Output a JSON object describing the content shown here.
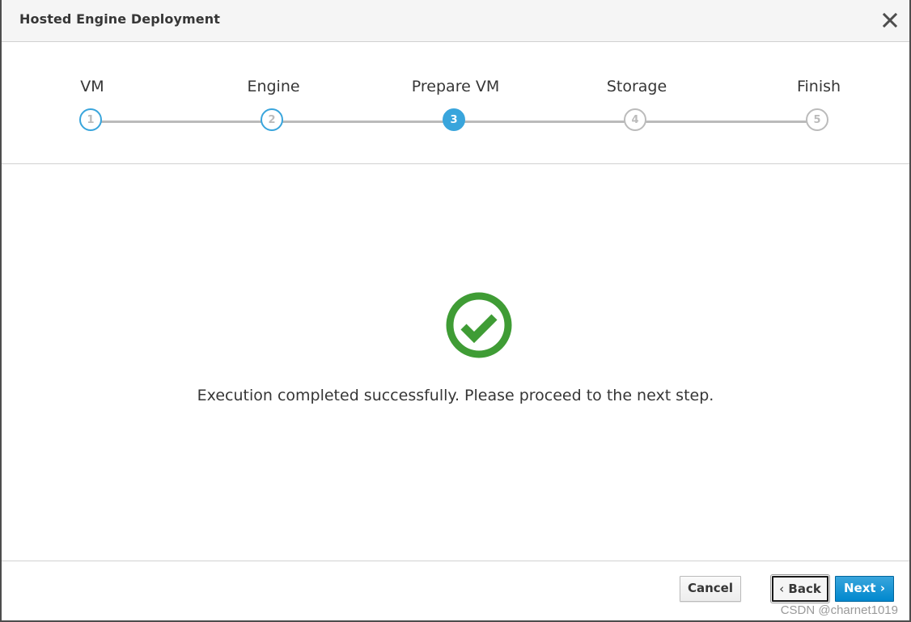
{
  "dialog": {
    "title": "Hosted Engine Deployment",
    "close_icon": "close-x-icon"
  },
  "wizard": {
    "steps": [
      {
        "number": "1",
        "label": "VM",
        "state": "done"
      },
      {
        "number": "2",
        "label": "Engine",
        "state": "done"
      },
      {
        "number": "3",
        "label": "Prepare VM",
        "state": "active"
      },
      {
        "number": "4",
        "label": "Storage",
        "state": "pending"
      },
      {
        "number": "5",
        "label": "Finish",
        "state": "pending"
      }
    ],
    "current_step": 3
  },
  "content": {
    "status_icon": "success-check-circle-icon",
    "message": "Execution completed successfully. Please proceed to the next step."
  },
  "footer": {
    "cancel_label": "Cancel",
    "back_label": "Back",
    "next_label": "Next"
  },
  "watermark": "CSDN @charnet1019",
  "colors": {
    "accent": "#39a5dc",
    "primary_button": "#0088ce",
    "success": "#3f9c35",
    "pending": "#bbbbbb"
  }
}
